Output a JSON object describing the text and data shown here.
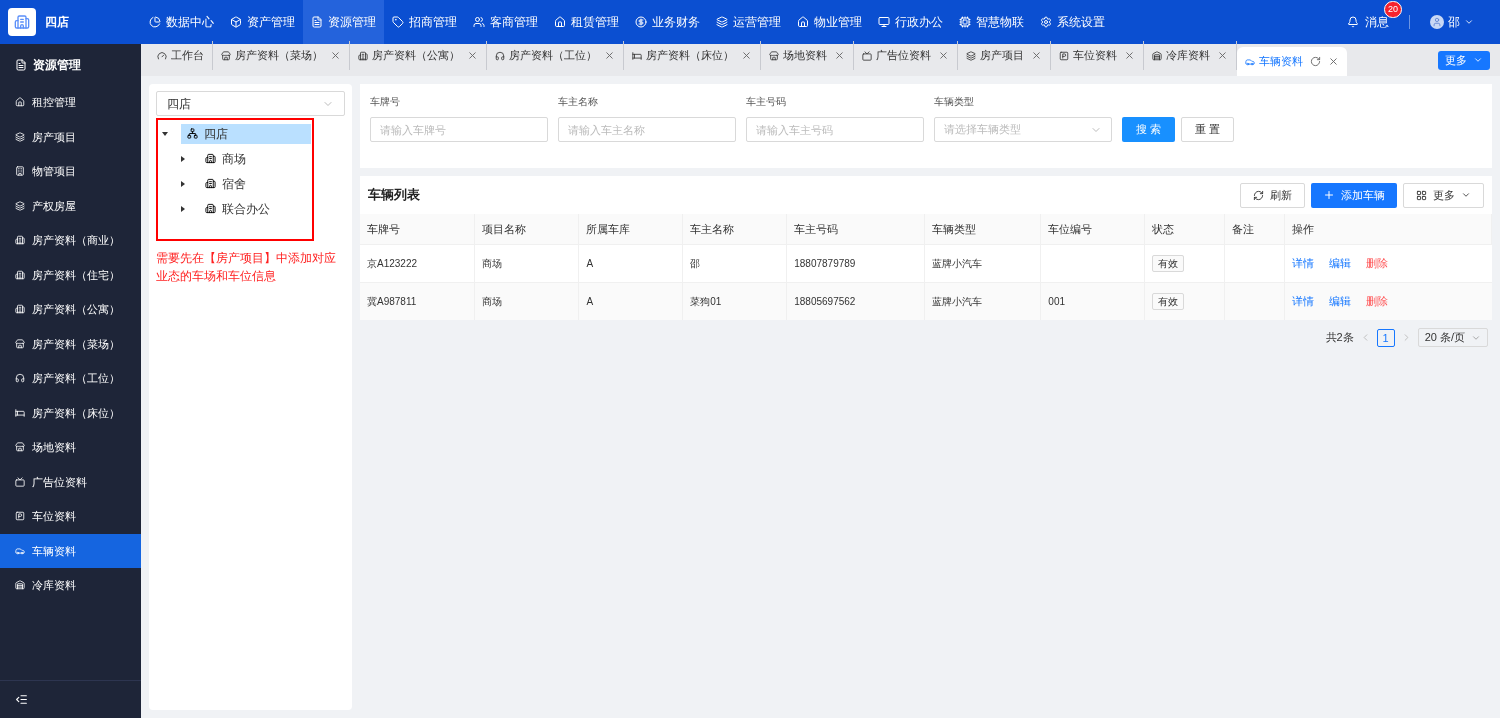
{
  "brand": {
    "name": "四店"
  },
  "top_nav": [
    {
      "label": "数据中心",
      "selected": false
    },
    {
      "label": "资产管理",
      "selected": false
    },
    {
      "label": "资源管理",
      "selected": true
    },
    {
      "label": "招商管理",
      "selected": false
    },
    {
      "label": "客商管理",
      "selected": false
    },
    {
      "label": "租赁管理",
      "selected": false
    },
    {
      "label": "业务财务",
      "selected": false
    },
    {
      "label": "运营管理",
      "selected": false
    },
    {
      "label": "物业管理",
      "selected": false
    },
    {
      "label": "行政办公",
      "selected": false
    },
    {
      "label": "智慧物联",
      "selected": false
    },
    {
      "label": "系统设置",
      "selected": false
    }
  ],
  "user_area": {
    "messages": "消息",
    "badge": "20",
    "user": "邵"
  },
  "sidebar": {
    "title": "资源管理",
    "items": [
      {
        "label": "租控管理",
        "selected": false
      },
      {
        "label": "房产项目",
        "selected": false
      },
      {
        "label": "物管项目",
        "selected": false
      },
      {
        "label": "产权房屋",
        "selected": false
      },
      {
        "label": "房产资料（商业）",
        "selected": false
      },
      {
        "label": "房产资料（住宅）",
        "selected": false
      },
      {
        "label": "房产资料（公寓）",
        "selected": false
      },
      {
        "label": "房产资料（菜场）",
        "selected": false
      },
      {
        "label": "房产资料（工位）",
        "selected": false
      },
      {
        "label": "房产资料（床位）",
        "selected": false
      },
      {
        "label": "场地资料",
        "selected": false
      },
      {
        "label": "广告位资料",
        "selected": false
      },
      {
        "label": "车位资料",
        "selected": false
      },
      {
        "label": "车辆资料",
        "selected": true
      },
      {
        "label": "冷库资料",
        "selected": false
      }
    ]
  },
  "tabs": [
    {
      "label": "工作台",
      "selected": false,
      "closable": false
    },
    {
      "label": "房产资料（菜场）",
      "selected": false,
      "closable": true
    },
    {
      "label": "房产资料（公寓）",
      "selected": false,
      "closable": true
    },
    {
      "label": "房产资料（工位）",
      "selected": false,
      "closable": true
    },
    {
      "label": "房产资料（床位）",
      "selected": false,
      "closable": true
    },
    {
      "label": "场地资料",
      "selected": false,
      "closable": true
    },
    {
      "label": "广告位资料",
      "selected": false,
      "closable": true
    },
    {
      "label": "房产项目",
      "selected": false,
      "closable": true
    },
    {
      "label": "车位资料",
      "selected": false,
      "closable": true
    },
    {
      "label": "冷库资料",
      "selected": false,
      "closable": true
    },
    {
      "label": "车辆资料",
      "selected": true,
      "closable": true
    }
  ],
  "tabs_more": "更多",
  "tree_panel": {
    "select_value": "四店",
    "tree": [
      {
        "label": "四店",
        "selected": true,
        "expanded": true,
        "children": [
          {
            "label": "商场",
            "selected": false,
            "expanded": false
          },
          {
            "label": "宿舍",
            "selected": false,
            "expanded": false
          },
          {
            "label": "联合办公",
            "selected": false,
            "expanded": false
          }
        ]
      }
    ],
    "note": "需要先在【房产项目】中添加对应业态的车场和车位信息"
  },
  "filters": [
    {
      "kind": "input",
      "label": "车牌号",
      "placeholder": "请输入车牌号"
    },
    {
      "kind": "input",
      "label": "车主名称",
      "placeholder": "请输入车主名称"
    },
    {
      "kind": "input",
      "label": "车主号码",
      "placeholder": "请输入车主号码"
    },
    {
      "kind": "select",
      "label": "车辆类型",
      "placeholder": "请选择车辆类型"
    }
  ],
  "filter_buttons": {
    "search": "搜 索",
    "reset": "重 置"
  },
  "table": {
    "title": "车辆列表",
    "actions": {
      "refresh": "刷新",
      "add": "添加车辆",
      "more": "更多"
    },
    "columns": [
      "车牌号",
      "项目名称",
      "所属车库",
      "车主名称",
      "车主号码",
      "车辆类型",
      "车位编号",
      "状态",
      "备注",
      "操作"
    ],
    "rows": [
      {
        "cells": [
          "京A123222",
          "商场",
          "A",
          "邵",
          "18807879789",
          "蓝牌小汽车",
          "",
          "有效",
          ""
        ],
        "links": [
          "详情",
          "编辑",
          "删除"
        ]
      },
      {
        "cells": [
          "冀A987811",
          "商场",
          "A",
          "菜狗01",
          "18805697562",
          "蓝牌小汽车",
          "001",
          "有效",
          ""
        ],
        "links": [
          "详情",
          "编辑",
          "删除"
        ]
      }
    ]
  },
  "pagination": {
    "total": "共2条",
    "pages": [
      {
        "label": "1",
        "selected": true
      }
    ],
    "page_size": "20 条/页"
  }
}
